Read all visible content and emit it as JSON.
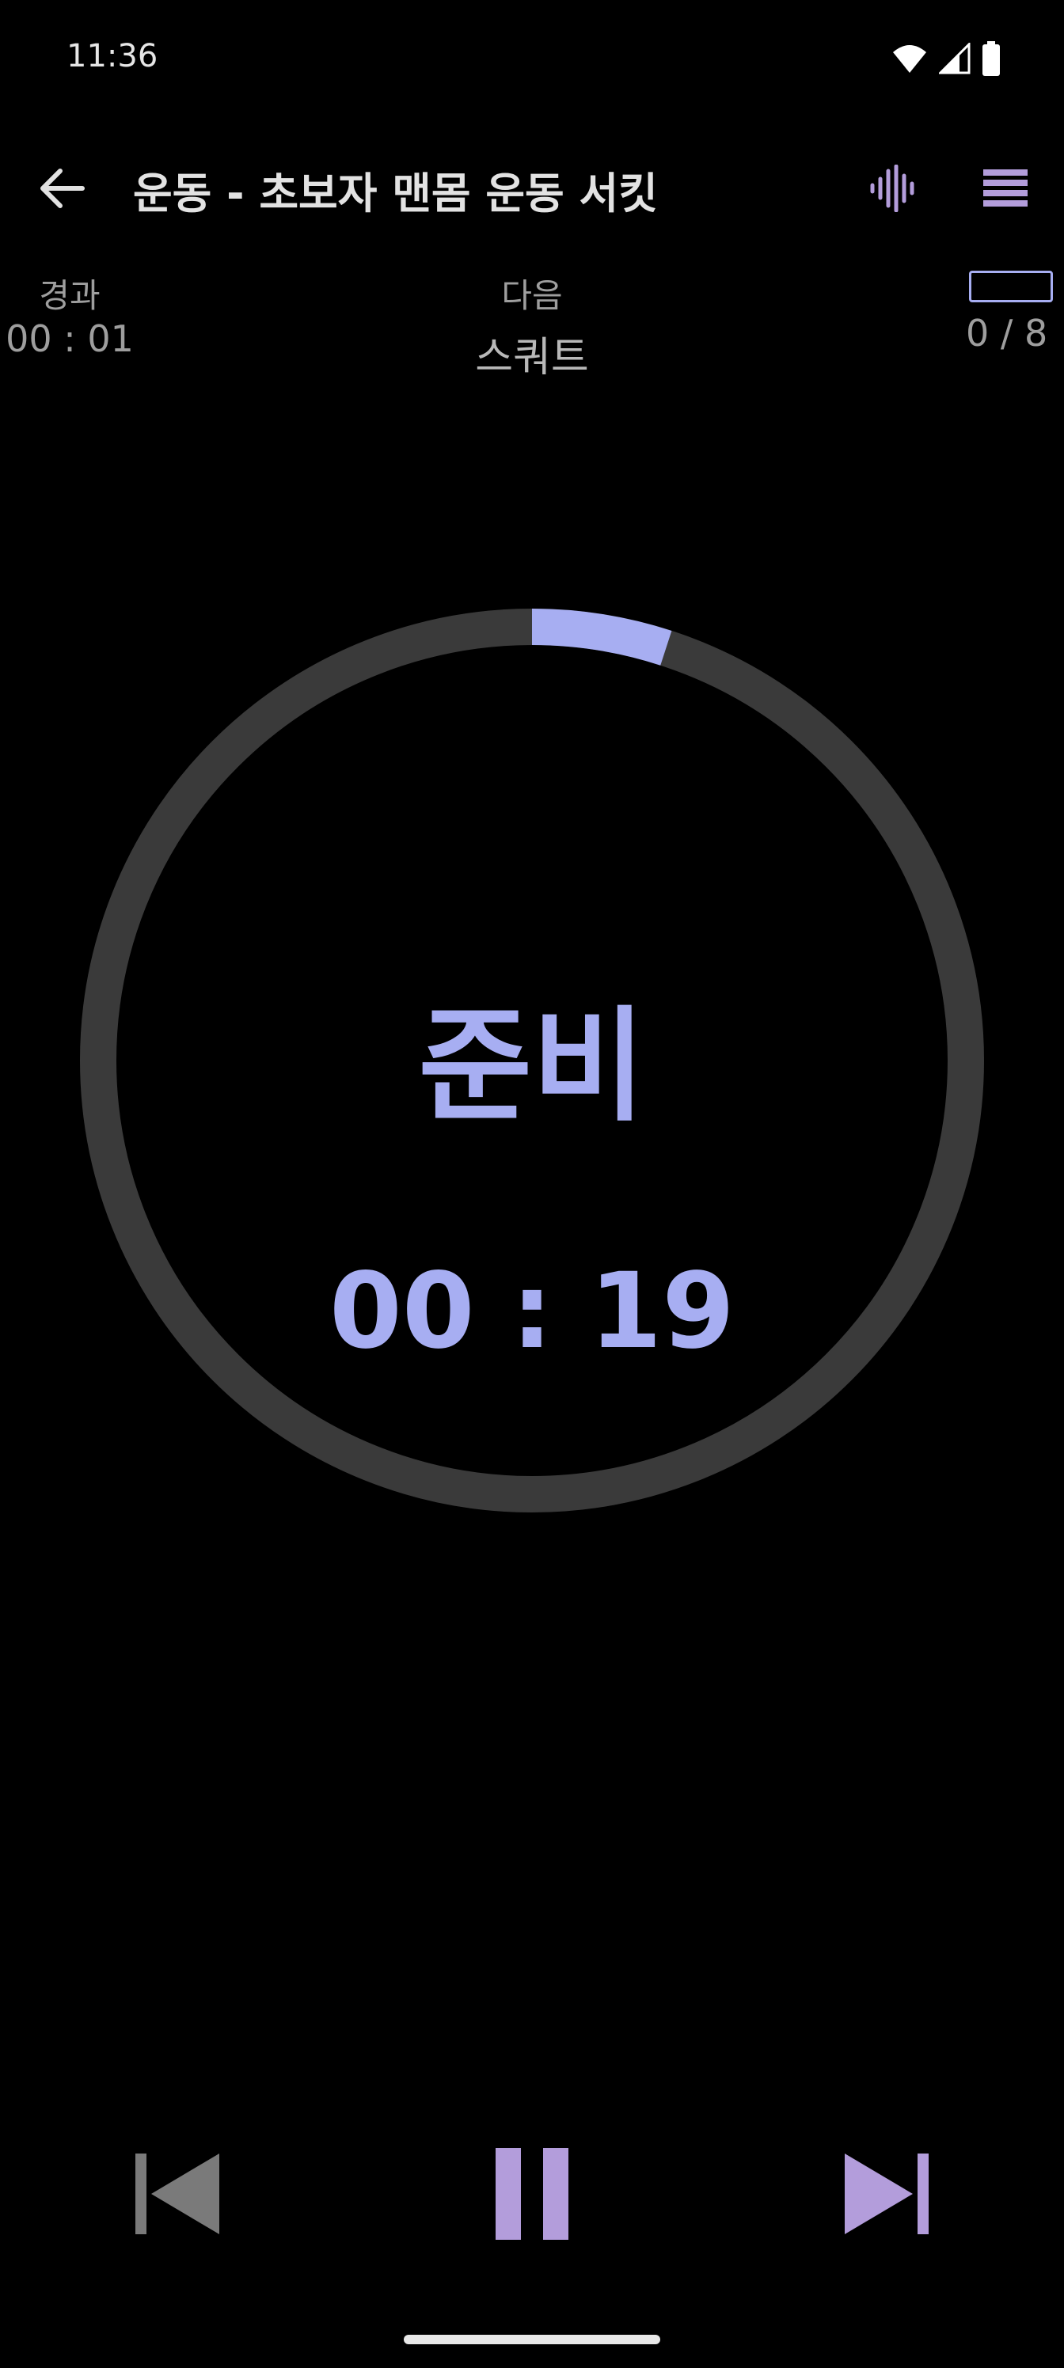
{
  "status_bar": {
    "time": "11:36"
  },
  "app_bar": {
    "title": "운동 - 초보자 맨몸 운동 서킷",
    "back_icon": "arrow-left-icon",
    "sound_icon": "sound-wave-icon",
    "list_icon": "list-icon"
  },
  "info": {
    "elapsed_label": "경과",
    "elapsed_value": "00 : 01",
    "next_label": "다음",
    "next_value": "스쿼트",
    "progress_value": "0 / 8"
  },
  "timer": {
    "phase": "준비",
    "time_left": "00 : 19",
    "ring_progress": 0.05
  },
  "controls": {
    "prev_icon": "skip-previous-icon",
    "pause_icon": "pause-icon",
    "next_icon": "skip-next-icon"
  },
  "colors": {
    "accent": "#a7aef2",
    "purple": "#b39ddb",
    "ring_track": "#3a3a3a",
    "disabled": "#7a7a7a"
  }
}
